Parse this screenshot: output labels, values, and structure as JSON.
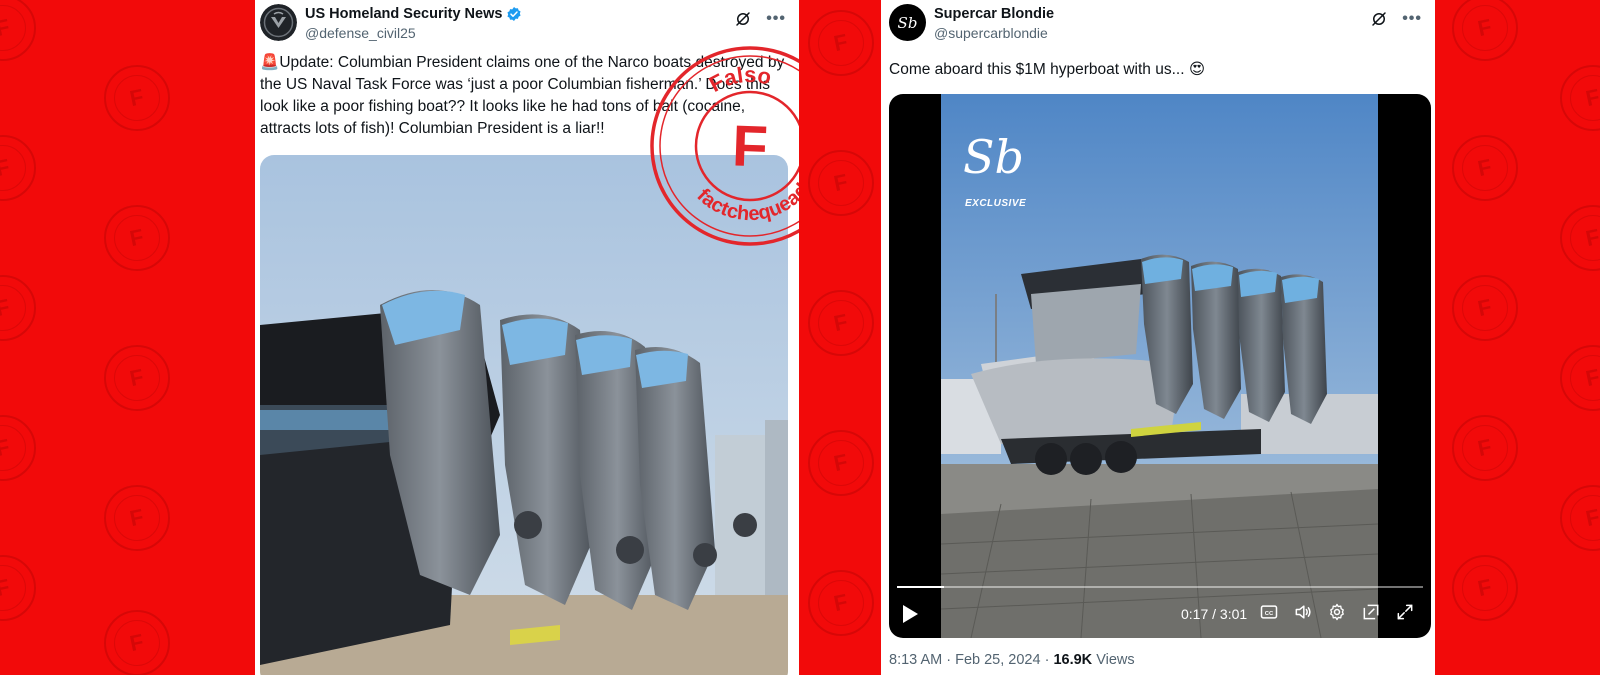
{
  "left_tweet": {
    "author": {
      "name": "US Homeland Security News",
      "handle": "@defense_civil25",
      "verified": true
    },
    "text_emoji": "🚨",
    "text": "Update: Columbian President claims one of the Narco boats destroyed by the US Naval Task Force was ‘just a poor Columbian fisherman.’ Does this look like a poor fishing boat?? It looks like he had tons of bait (cocaine, attracts lots of fish)! Columbian President is a liar!!",
    "icons": [
      "grok-icon",
      "more-icon"
    ]
  },
  "stamp": {
    "top_word": "Falso",
    "letter": "F",
    "bottom_word": "factchequeado"
  },
  "right_tweet": {
    "author": {
      "name": "Supercar Blondie",
      "handle": "@supercarblondie",
      "avatar_text": "Sb"
    },
    "text": "Come aboard this $1M hyperboat with us... 😍",
    "video": {
      "brand_mark": "Sb",
      "badge": "EXCLUSIVE",
      "time": "0:17 / 3:01",
      "progress": 0.09
    },
    "meta": {
      "time": "8:13 AM",
      "separator": " · ",
      "date": "Feb 25, 2024",
      "views_count": "16.9K",
      "views_label": "Views"
    },
    "icons": [
      "grok-icon",
      "more-icon"
    ]
  },
  "colors": {
    "background": "#f20a0a",
    "stamp_red": "#e3262b",
    "verified_blue": "#1d9bf0",
    "secondary_text": "#536471"
  }
}
